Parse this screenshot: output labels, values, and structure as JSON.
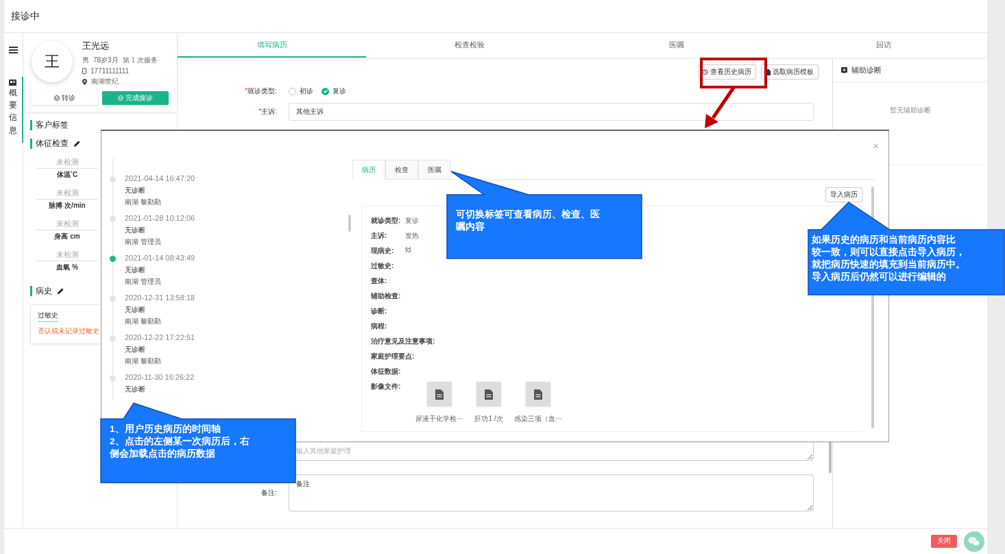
{
  "header": {
    "title": "接诊中"
  },
  "nav": {
    "label": "概要信息"
  },
  "patient": {
    "avatar_text": "王",
    "name": "王光远",
    "gender": "男",
    "age": "78岁3月",
    "visit_prefix": "第",
    "visit_count": "1",
    "visit_suffix": "次服务",
    "phone": "17711111111",
    "location": "南湖世纪",
    "buttons": [
      {
        "label": "转诊",
        "kind": "plain"
      },
      {
        "label": "完成接诊",
        "kind": "primary"
      }
    ]
  },
  "sections": [
    {
      "title": "客户标签",
      "editable": false
    },
    {
      "title": "体征检查",
      "editable": true
    }
  ],
  "vitals": [
    {
      "value": "未检测",
      "label": "体温˚C"
    },
    {
      "value": "未检测",
      "label": "脉搏 次/min"
    },
    {
      "value": "未检测",
      "label": "身高 cm"
    },
    {
      "value": "未检测",
      "label": "血氧 %"
    }
  ],
  "history_section": {
    "title": "病史",
    "editable": true,
    "card_title": "过敏史",
    "card_text": "否认或未记录过敏史"
  },
  "tabs": [
    {
      "label": "填写病历",
      "selected": true
    },
    {
      "label": "检查检验",
      "selected": false
    },
    {
      "label": "医嘱",
      "selected": false
    },
    {
      "label": "回访",
      "selected": false
    }
  ],
  "toolbar": [
    {
      "label": "查看历史病历"
    },
    {
      "label": "选取病历模板"
    }
  ],
  "form": {
    "visit_type": {
      "required_mark": "*",
      "label": "就诊类型:",
      "options": [
        {
          "label": "初诊",
          "selected": false
        },
        {
          "label": "复诊",
          "selected": true
        }
      ]
    },
    "complaint": {
      "required_mark": "*",
      "label": "主诉:",
      "value": "其他主诉"
    },
    "home_care": {
      "placeholder": "输入其他家庭护理"
    },
    "remark": {
      "label": "备注:",
      "value": "备注"
    }
  },
  "assist": {
    "title": "辅助诊断",
    "empty": "暂无辅助诊断"
  },
  "modal": {
    "close": "×",
    "timeline": [
      {
        "date": "2021-04-14 16:47:20",
        "diagnosis": "无诊断",
        "author": "南湖 黎勤勤",
        "selected": false
      },
      {
        "date": "2021-01-28 10:12:06",
        "diagnosis": "无诊断",
        "author": "南湖 管理员",
        "selected": false
      },
      {
        "date": "2021-01-14 08:43:49",
        "diagnosis": "无诊断",
        "author": "南湖 管理员",
        "selected": true
      },
      {
        "date": "2020-12-31 13:58:18",
        "diagnosis": "无诊断",
        "author": "南湖 黎勤勤",
        "selected": false
      },
      {
        "date": "2020-12-22 17:22:51",
        "diagnosis": "无诊断",
        "author": "南湖 黎勤勤",
        "selected": false
      },
      {
        "date": "2020-11-30 16:26:22",
        "diagnosis": "无诊断",
        "selected": false
      }
    ],
    "tabs": [
      {
        "label": "病历",
        "selected": true
      },
      {
        "label": "检查",
        "selected": false
      },
      {
        "label": "医嘱",
        "selected": false
      }
    ],
    "import_button": "导入病历",
    "record": [
      {
        "label": "就诊类型:",
        "value": "复诊"
      },
      {
        "label": "主诉:",
        "value": "发热"
      },
      {
        "label": "现病史:",
        "value": "fd"
      },
      {
        "label": "过敏史:"
      },
      {
        "label": "查体:"
      },
      {
        "label": "辅助检查:"
      },
      {
        "label": "诊断:"
      },
      {
        "label": "病程:"
      },
      {
        "label": "治疗意见及注意事项:"
      },
      {
        "label": "家庭护理要点:"
      },
      {
        "label": "体征数据:"
      }
    ],
    "files_label": "影像文件:",
    "files": [
      {
        "name": "尿液干化学检⋯"
      },
      {
        "name": "肝功1 /次"
      },
      {
        "name": "感染三项（血⋯"
      }
    ]
  },
  "callouts": [
    {
      "lines": [
        "可切换标签可查看病历、检查、医",
        "嘱内容"
      ]
    },
    {
      "lines": [
        "如果历史的病历和当前病历内容比",
        "较一致，则可以直接点击导入病历，",
        "就把病历快速的填充到当前病历中。",
        "导入病历后仍然可以进行编辑的"
      ]
    },
    {
      "lines": [
        "1、用户历史病历的时间轴",
        "2、点击的左侧某一次病历后，右",
        "侧会加载点击的病历数据"
      ]
    }
  ],
  "footer": {
    "close_button": "关闭"
  }
}
